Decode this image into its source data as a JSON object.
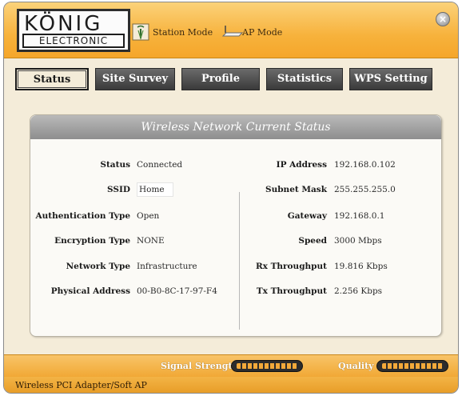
{
  "header": {
    "logo_top": "KÖNIG",
    "logo_bottom": "ELECTRONIC",
    "station_mode_label": "Station Mode",
    "ap_mode_label": "AP Mode"
  },
  "tabs": [
    {
      "label": "Status",
      "active": true
    },
    {
      "label": "Site Survey",
      "active": false
    },
    {
      "label": "Profile",
      "active": false
    },
    {
      "label": "Statistics",
      "active": false
    },
    {
      "label": "WPS Setting",
      "active": false
    }
  ],
  "panel": {
    "title": "Wireless Network Current Status",
    "left_fields": [
      {
        "label": "Status",
        "value": "Connected"
      },
      {
        "label": "SSID",
        "value": "Home"
      },
      {
        "label": "Authentication Type",
        "value": "Open"
      },
      {
        "label": "Encryption Type",
        "value": "NONE"
      },
      {
        "label": "Network Type",
        "value": "Infrastructure"
      },
      {
        "label": "Physical Address",
        "value": "00-B0-8C-17-97-F4"
      }
    ],
    "right_fields": [
      {
        "label": "IP Address",
        "value": "192.168.0.102"
      },
      {
        "label": "Subnet Mask",
        "value": "255.255.255.0"
      },
      {
        "label": "Gateway",
        "value": "192.168.0.1"
      },
      {
        "label": "Speed",
        "value": "3000 Mbps"
      },
      {
        "label": "Rx Throughput",
        "value": "19.816 Kbps"
      },
      {
        "label": "Tx Throughput",
        "value": "2.256 Kbps"
      }
    ]
  },
  "bottom": {
    "signal_label": "Signal Strength",
    "signal_level": 1.0,
    "quality_label": "Quality",
    "quality_level": 1.0
  },
  "statusbar": {
    "text": "Wireless PCI Adapter/Soft AP"
  },
  "colors": {
    "header_orange": "#f7b23c",
    "tab_dark": "#3a3a3a",
    "panel_title_gray": "#9a9a9a",
    "meter_fill": "#f2a93a"
  }
}
